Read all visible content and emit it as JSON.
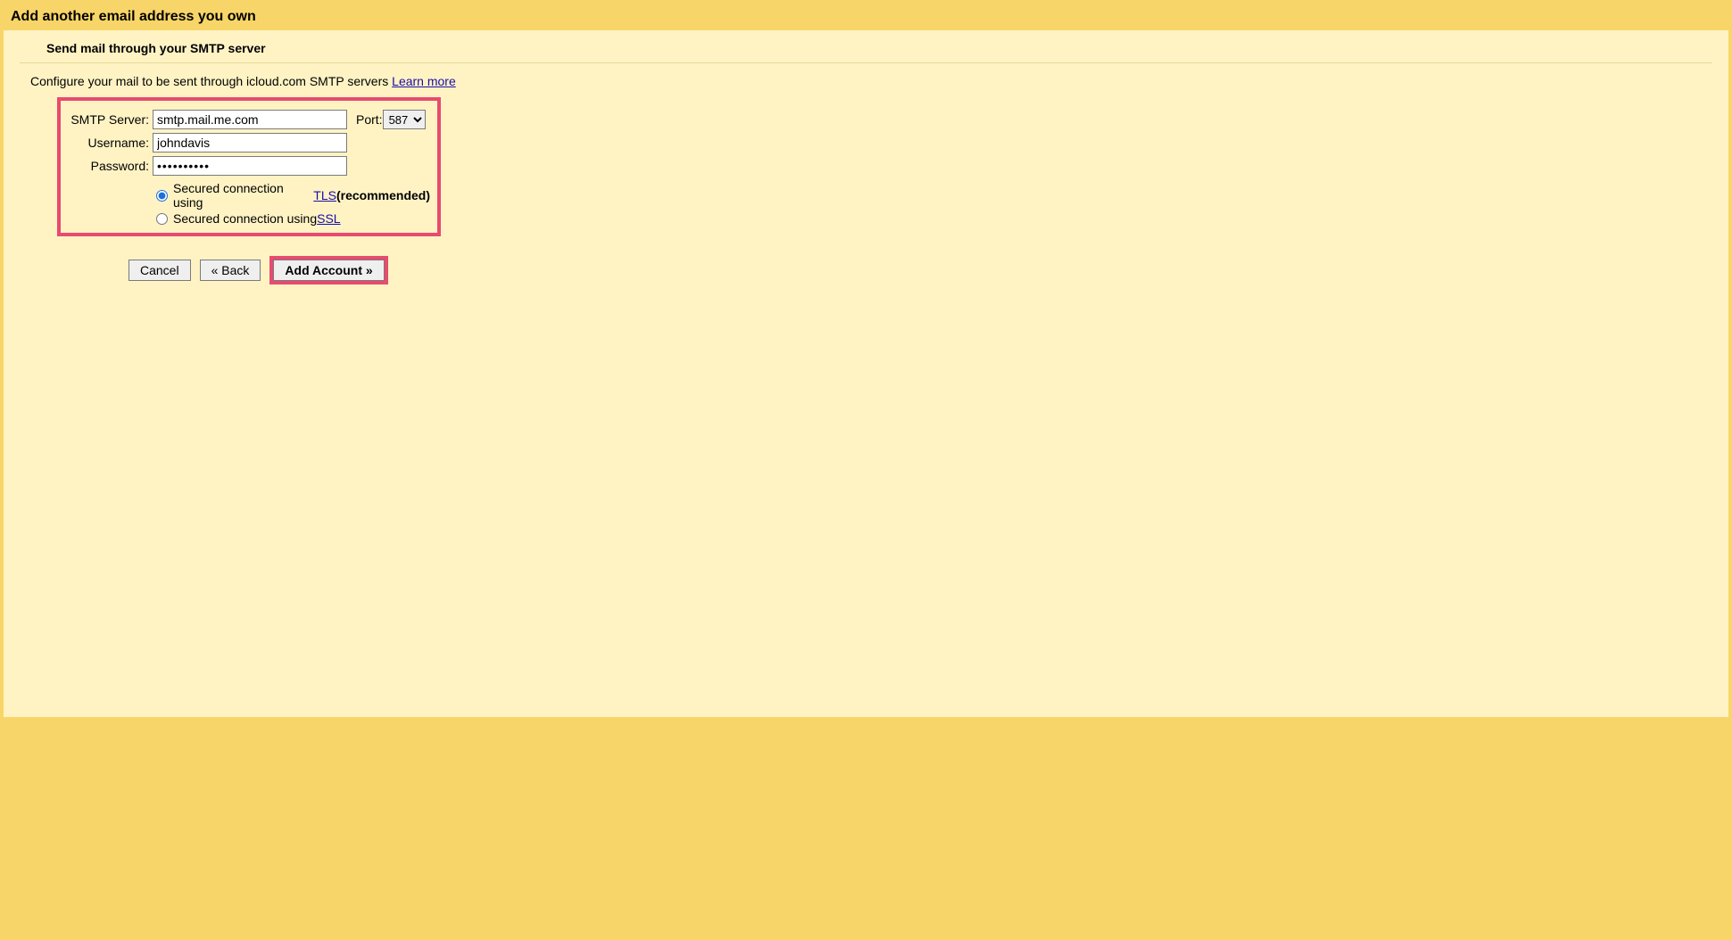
{
  "header": {
    "title": "Add another email address you own"
  },
  "subheader": "Send mail through your SMTP server",
  "config_text_prefix": "Configure your mail to be sent through icloud.com SMTP servers ",
  "learn_more": "Learn more",
  "form": {
    "smtp_label": "SMTP Server:",
    "smtp_value": "smtp.mail.me.com",
    "port_label": "Port:",
    "port_value": "587",
    "username_label": "Username:",
    "username_value": "johndavis",
    "password_label": "Password:",
    "password_value": "••••••••••",
    "tls_prefix": "Secured connection using ",
    "tls_link": "TLS",
    "tls_suffix": " (recommended)",
    "ssl_prefix": "Secured connection using ",
    "ssl_link": "SSL"
  },
  "buttons": {
    "cancel": "Cancel",
    "back": "« Back",
    "add": "Add Account »"
  }
}
